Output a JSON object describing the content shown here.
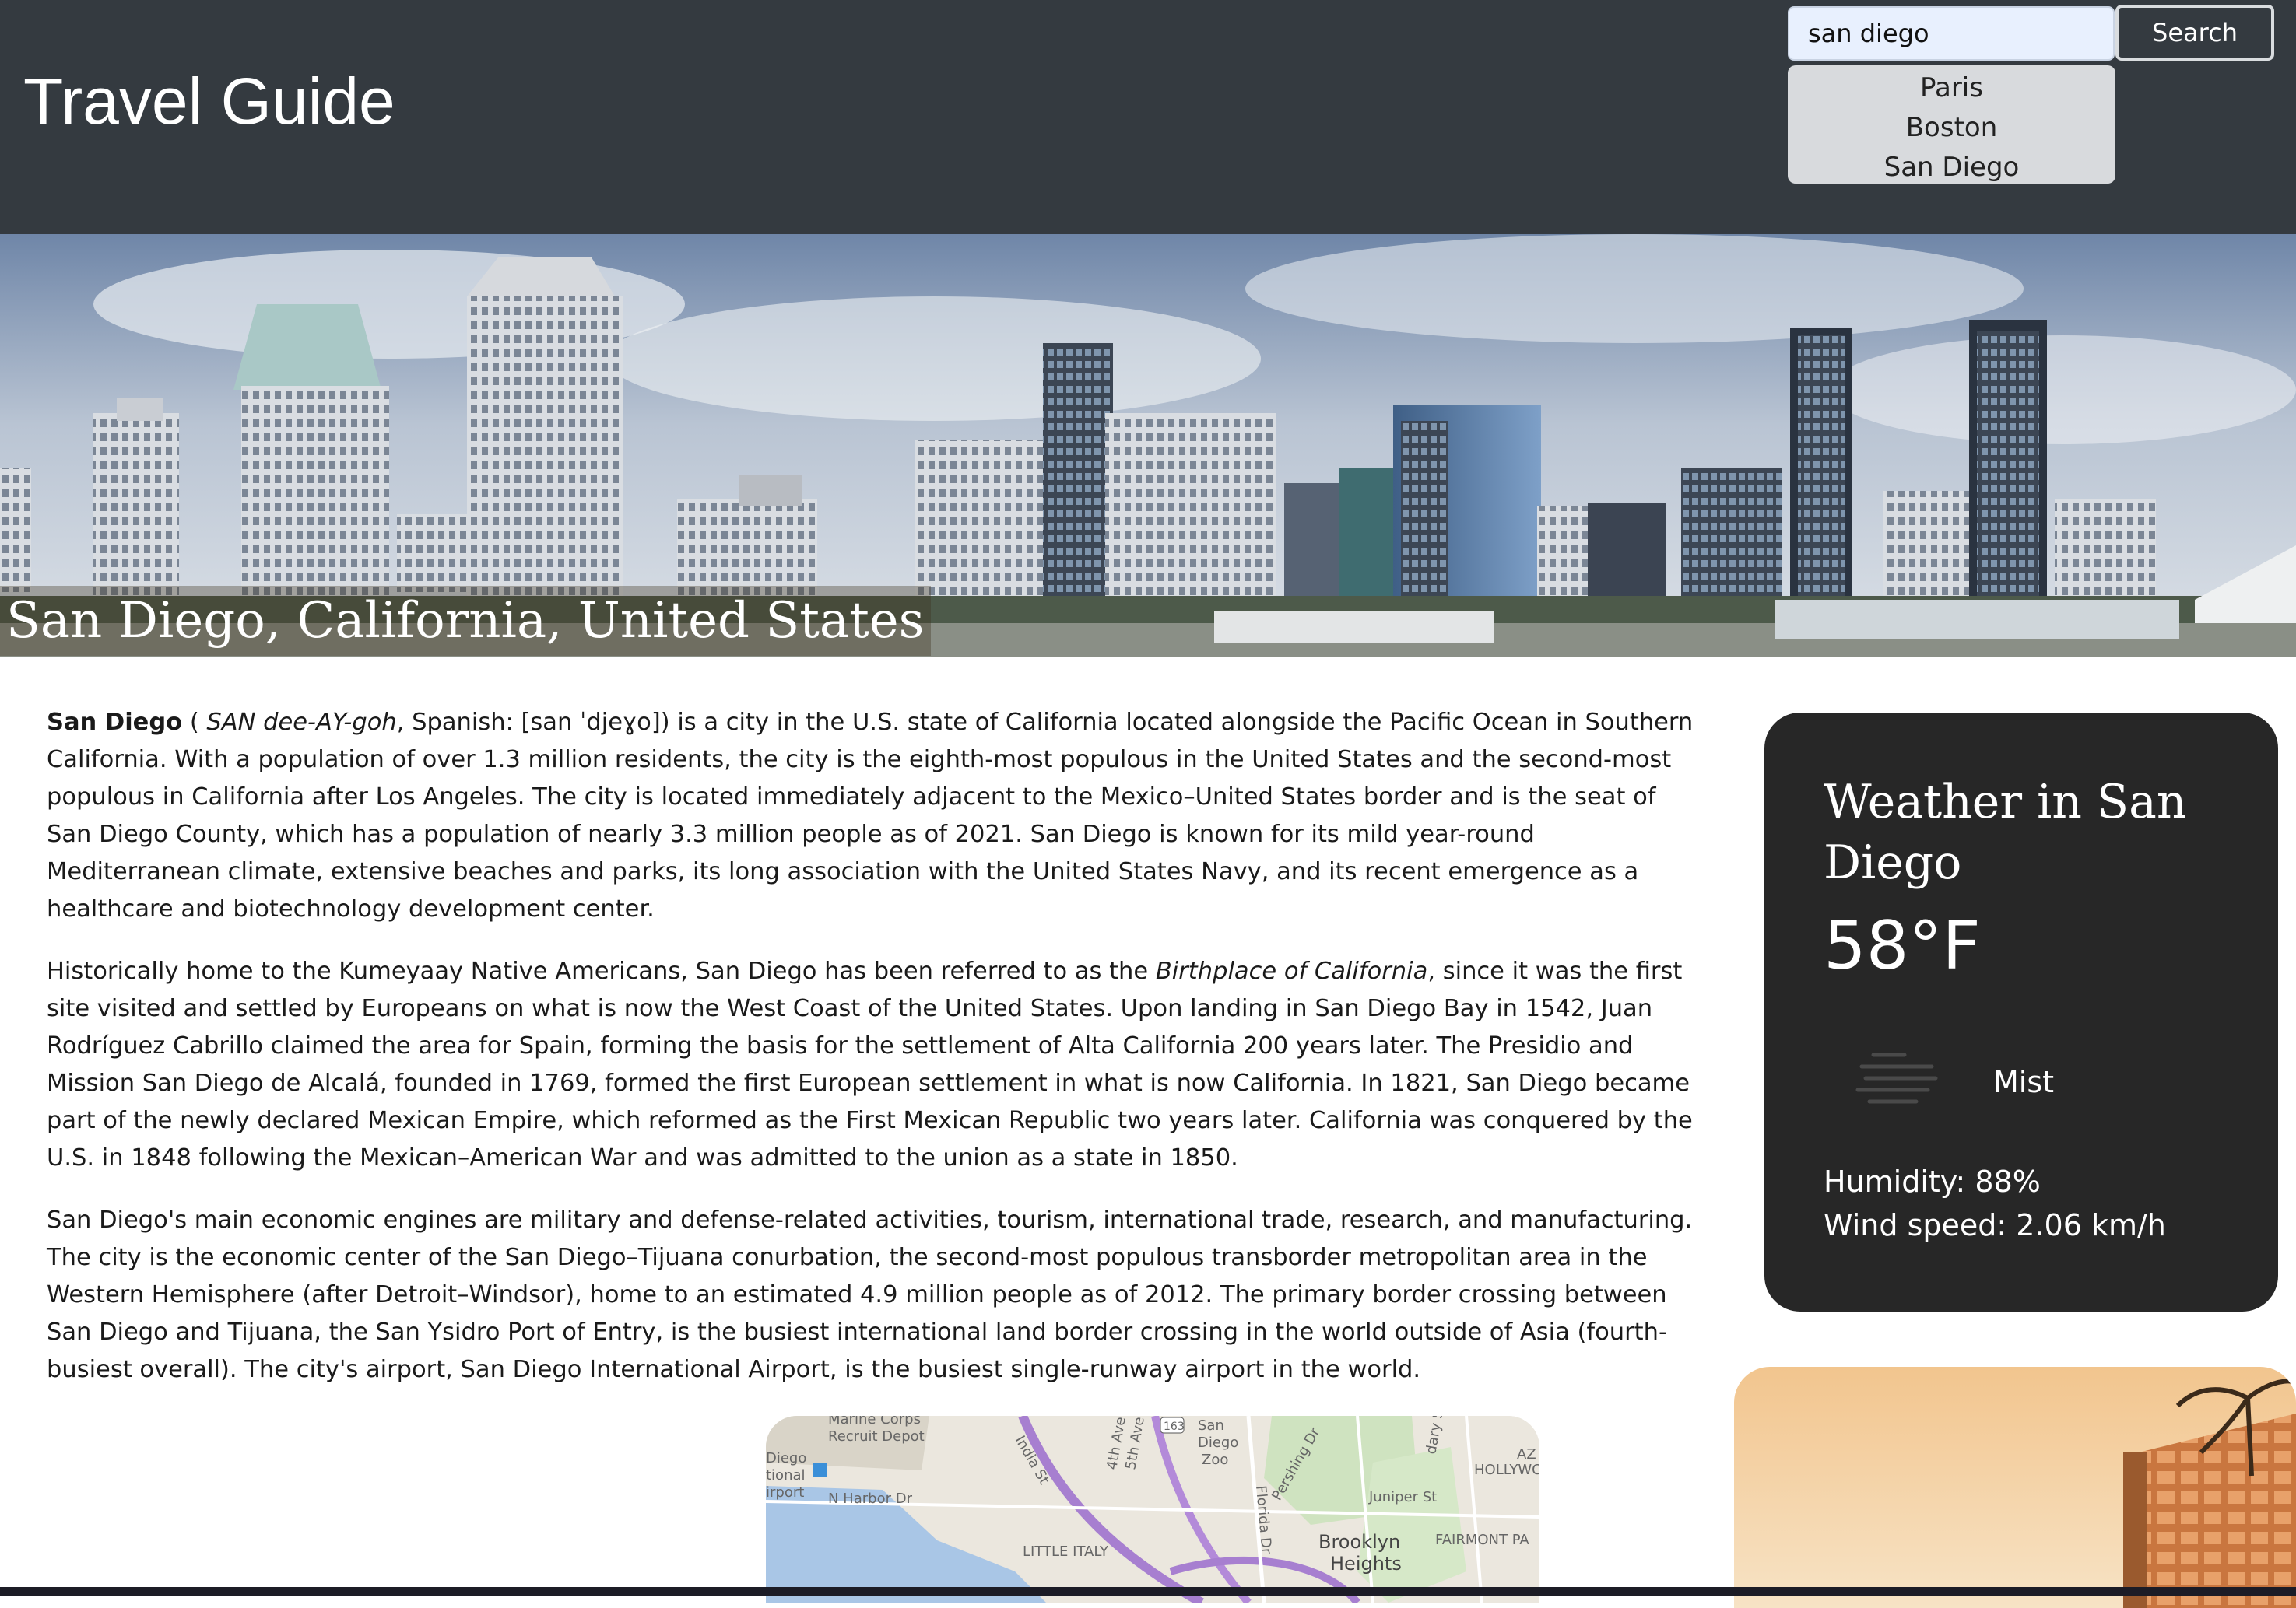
{
  "header": {
    "title": "Travel Guide",
    "search": {
      "value": "san diego",
      "button_label": "Search"
    },
    "suggestions": [
      "Paris",
      "Boston",
      "San Diego"
    ]
  },
  "hero": {
    "caption": "San Diego, California, United States"
  },
  "article": {
    "p1": {
      "name": "San Diego",
      "open": " ( ",
      "pronunciation": "SAN dee-AY-goh",
      "rest": ", Spanish: [san ˈdjeɣo]) is a city in the U.S. state of California located alongside the Pacific Ocean in Southern California. With a population of over 1.3 million residents, the city is the eighth-most populous in the United States and the second-most populous in California after Los Angeles. The city is located immediately adjacent to the Mexico–United States border and is the seat of San Diego County, which has a population of nearly 3.3 million people as of 2021. San Diego is known for its mild year-round Mediterranean climate, extensive beaches and parks, its long association with the United States Navy, and its recent emergence as a healthcare and biotechnology development center."
    },
    "p2": {
      "before": "Historically home to the Kumeyaay Native Americans, San Diego has been referred to as the ",
      "emphasis": "Birthplace of California",
      "after": ", since it was the first site visited and settled by Europeans on what is now the West Coast of the United States. Upon landing in San Diego Bay in 1542, Juan Rodríguez Cabrillo claimed the area for Spain, forming the basis for the settlement of Alta California 200 years later. The Presidio and Mission San Diego de Alcalá, founded in 1769, formed the first European settlement in what is now California. In 1821, San Diego became part of the newly declared Mexican Empire, which reformed as the First Mexican Republic two years later. California was conquered by the U.S. in 1848 following the Mexican–American War and was admitted to the union as a state in 1850."
    },
    "p3": "San Diego's main economic engines are military and defense-related activities, tourism, international trade, research, and manufacturing. The city is the economic center of the San Diego–Tijuana conurbation, the second-most populous transborder metropolitan area in the Western Hemisphere (after Detroit–Windsor), home to an estimated 4.9 million people as of 2012. The primary border crossing between San Diego and Tijuana, the San Ysidro Port of Entry, is the busiest international land border crossing in the world outside of Asia (fourth-busiest overall). The city's airport, San Diego International Airport, is the busiest single-runway airport in the world."
  },
  "map": {
    "labels": [
      "Marine Corps",
      "Recruit Depot",
      "Diego",
      "tional",
      "irport",
      "N Harbor Dr",
      "India St",
      "4th Ave",
      "5th Ave",
      "163",
      "San",
      "Diego",
      "Zoo",
      "Pershing Dr",
      "Florida Dr",
      "Juniper St",
      "dary St",
      "HOLLYWO",
      "AZ",
      "LITTLE ITALY",
      "Brooklyn",
      "Heights",
      "FAIRMONT PA"
    ]
  },
  "weather": {
    "title": "Weather in San Diego",
    "temperature": "58°F",
    "icon": "mist-icon",
    "description": "Mist",
    "humidity": "Humidity: 88%",
    "wind": "Wind speed: 2.06 km/h"
  },
  "colors": {
    "header_bg": "#343a40",
    "weather_card_bg": "#272727",
    "search_input_bg": "#e8f0fe",
    "suggestions_bg": "#d8dadd"
  }
}
